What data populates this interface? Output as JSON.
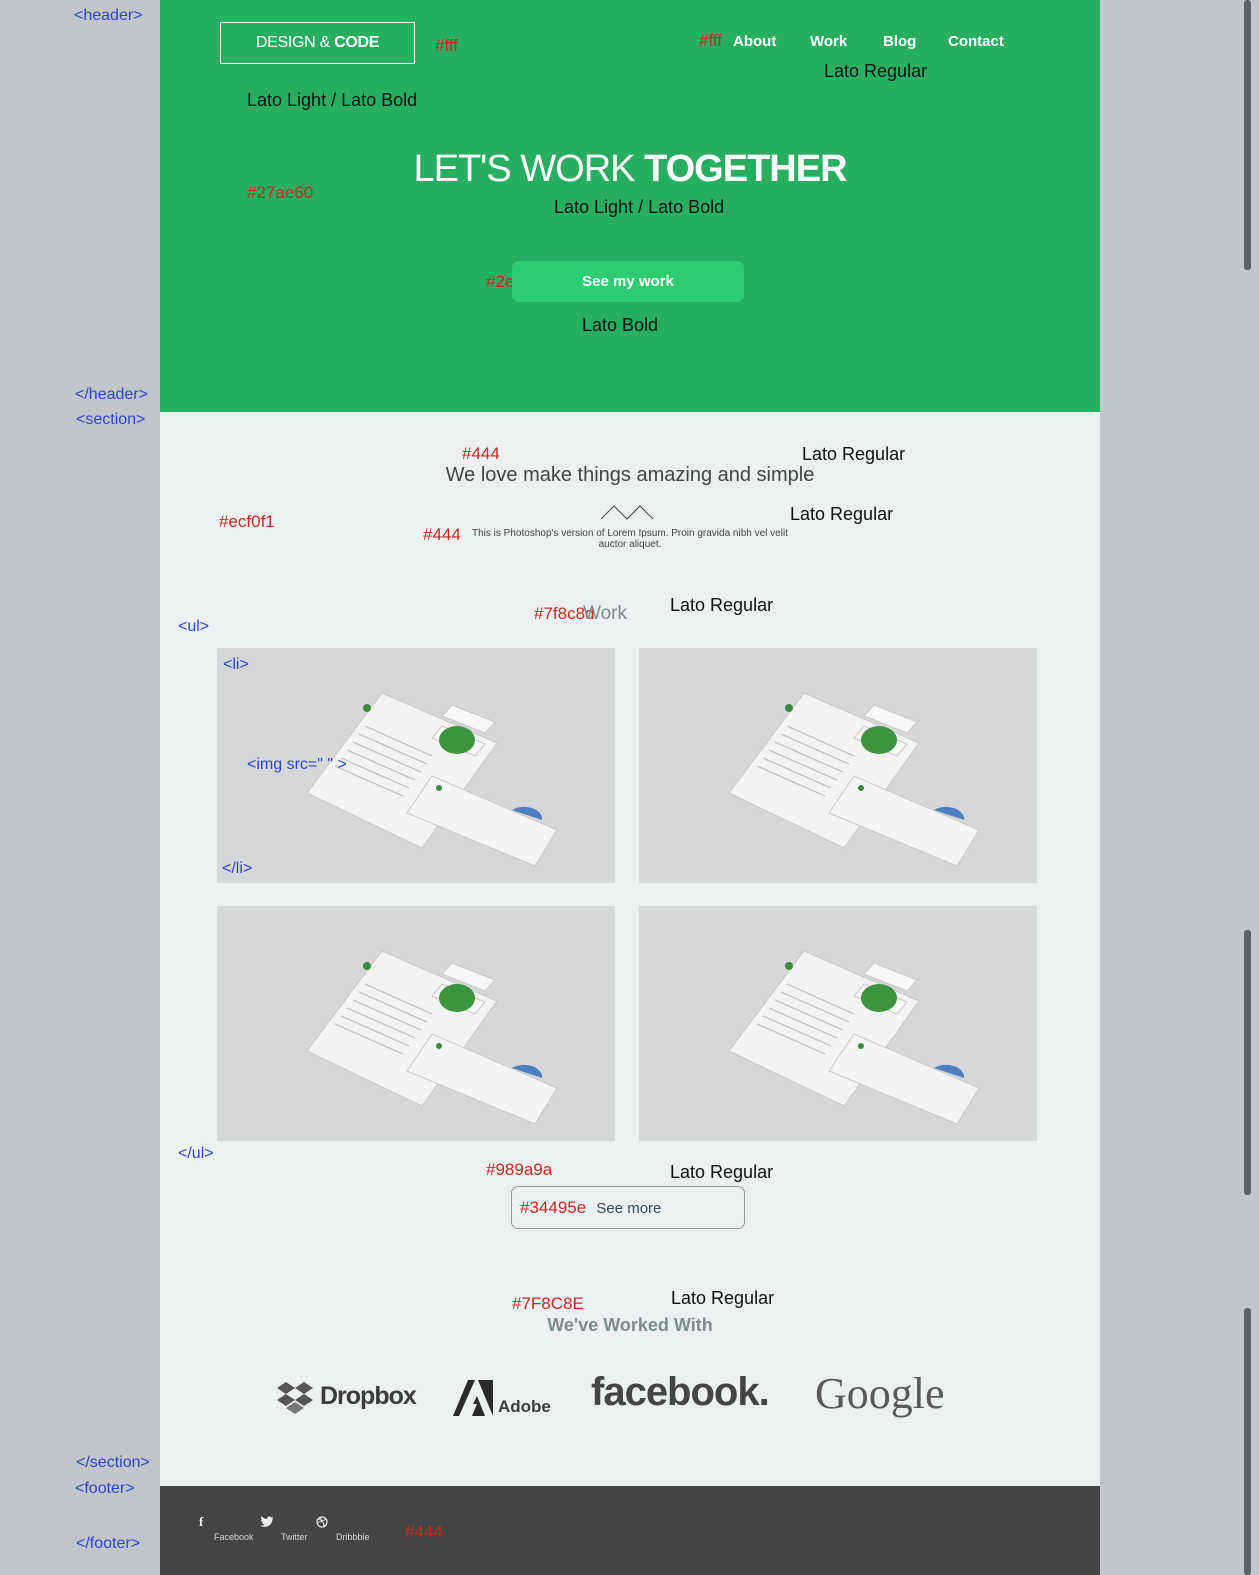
{
  "annotations": {
    "tags": {
      "header_open": "<header>",
      "header_close": "</header>",
      "section_open": "<section>",
      "ul_open": "<ul>",
      "li_open": "<li>",
      "img": "<img src=\" \" >",
      "li_close": "</li>",
      "ul_close": "</ul>",
      "section_close": "</section>",
      "footer_open": "<footer>",
      "footer_close": "</footer>"
    },
    "colors": {
      "logo": "#fff",
      "nav": "#fff",
      "header_bg": "#27ae60",
      "button": "#2ecc71",
      "lead": "#444",
      "section_bg": "#ecf0f1",
      "sub": "#444",
      "work_label": "#7f8c8d",
      "more_border": "#989a9a",
      "more_text": "#34495e",
      "clients_label": "#7F8C8E",
      "footer": "#444"
    },
    "fonts": {
      "logo": "Lato Light / Lato Bold",
      "nav": "Lato Regular",
      "hero": "Lato Light / Lato Bold",
      "button": "Lato Bold",
      "lead": "Lato Regular",
      "sub": "Lato Regular",
      "work": "Lato Regular",
      "more": "Lato Regular",
      "clients": "Lato Regular"
    }
  },
  "header": {
    "logo_light": "DESIGN & ",
    "logo_bold": "CODE",
    "nav": [
      "About",
      "Work",
      "Blog",
      "Contact"
    ],
    "hero_light": "LET'S WORK ",
    "hero_bold": "TOGETHER",
    "cta": "See my work"
  },
  "section": {
    "lead": "We love make things amazing and simple",
    "sub": "This is Photoshop's version of Lorem Ipsum. Proin gravida nibh vel velit auctor aliquet.",
    "work_label": "Work",
    "more": "See more",
    "clients_label": "We've Worked With",
    "clients": [
      "Dropbox",
      "Adobe",
      "facebook.",
      "Google"
    ]
  },
  "footer": {
    "links": [
      "Facebook",
      "Twitter",
      "Dribbble"
    ]
  }
}
